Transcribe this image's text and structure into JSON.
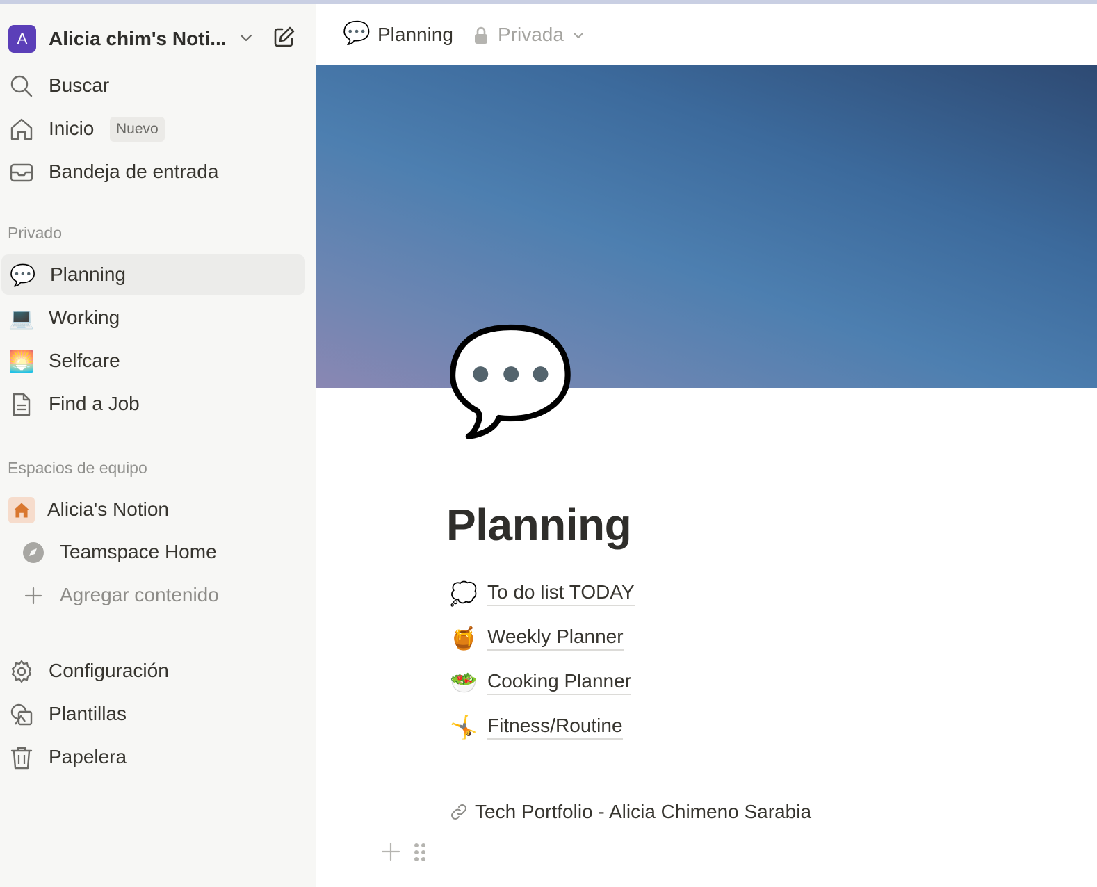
{
  "workspace": {
    "avatar_letter": "A",
    "name": "Alicia chim's Noti...",
    "accent": "#5b3fb8"
  },
  "sidebar": {
    "top_items": [
      {
        "label": "Buscar",
        "icon": "search-icon"
      },
      {
        "label": "Inicio",
        "icon": "home-icon",
        "badge": "Nuevo"
      },
      {
        "label": "Bandeja de entrada",
        "icon": "inbox-icon"
      }
    ],
    "private_section": {
      "title": "Privado",
      "items": [
        {
          "label": "Planning",
          "icon": "💬",
          "active": true
        },
        {
          "label": "Working",
          "icon": "💻"
        },
        {
          "label": "Selfcare",
          "icon": "🌅"
        },
        {
          "label": "Find a Job",
          "icon": "page-icon"
        }
      ]
    },
    "teamspace_section": {
      "title": "Espacios de equipo",
      "teamspace": {
        "label": "Alicia's Notion",
        "icon": "house-icon"
      },
      "items": [
        {
          "label": "Teamspace Home",
          "icon": "compass-icon"
        },
        {
          "label": "Agregar contenido",
          "icon": "plus-icon"
        }
      ]
    },
    "bottom_items": [
      {
        "label": "Configuración",
        "icon": "gear-icon"
      },
      {
        "label": "Plantillas",
        "icon": "templates-icon"
      },
      {
        "label": "Papelera",
        "icon": "trash-icon"
      }
    ]
  },
  "topbar": {
    "breadcrumb_icon": "💬",
    "breadcrumb_title": "Planning",
    "privacy_label": "Privada"
  },
  "page": {
    "icon": "💬",
    "title": "Planning",
    "links": [
      {
        "emoji": "💭",
        "label": "To do list TODAY"
      },
      {
        "emoji": "🍯",
        "label": "Weekly Planner"
      },
      {
        "emoji": "🥗",
        "label": "Cooking Planner"
      },
      {
        "emoji": "🤸",
        "label": "Fitness/Routine"
      }
    ],
    "bookmark": "Tech Portfolio - Alicia Chimeno Sarabia"
  }
}
